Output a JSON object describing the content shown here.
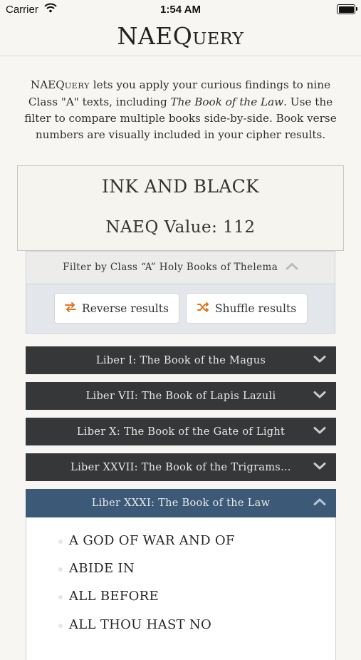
{
  "status_bar": {
    "carrier": "Carrier",
    "time": "1:54 AM"
  },
  "header": {
    "title_main": "NAEQ",
    "title_sc": "uery"
  },
  "intro": {
    "app_main": "NAEQ",
    "app_sc": "uery",
    "text_before_title": " lets you apply your curious findings to nine Class \"A\" texts, including ",
    "book_title": "The Book of the Law",
    "text_after_title": ". Use the filter to compare multiple books side-by-side. Book verse numbers are visually included in your cipher results."
  },
  "result": {
    "phrase": "INK AND BLACK",
    "value_text": "NAEQ Value: 112"
  },
  "filter": {
    "label": "Filter by Class “A” Holy Books of Thelema",
    "reverse_label": "Reverse results",
    "shuffle_label": "Shuffle results"
  },
  "books": [
    {
      "title": "Liber I: The Book of the Magus",
      "expanded": false
    },
    {
      "title": "Liber VII: The Book of Lapis Lazuli",
      "expanded": false
    },
    {
      "title": "Liber X: The Book of the Gate of Light",
      "expanded": false
    },
    {
      "title": "Liber XXVII: The Book of the Trigrams…",
      "expanded": false
    },
    {
      "title": "Liber XXXI: The Book of the Law",
      "expanded": true
    }
  ],
  "matches": [
    "A GOD OF WAR AND OF",
    "ABIDE IN",
    "ALL BEFORE",
    "ALL THOU HAST NO"
  ],
  "colors": {
    "dark_bar": "#363739",
    "active_bar": "#3c5a78",
    "accent": "#e2741c"
  },
  "icons": [
    "wifi-icon",
    "battery-icon",
    "chevron-up-icon",
    "chevron-down-icon",
    "swap-arrows-icon",
    "shuffle-icon"
  ]
}
